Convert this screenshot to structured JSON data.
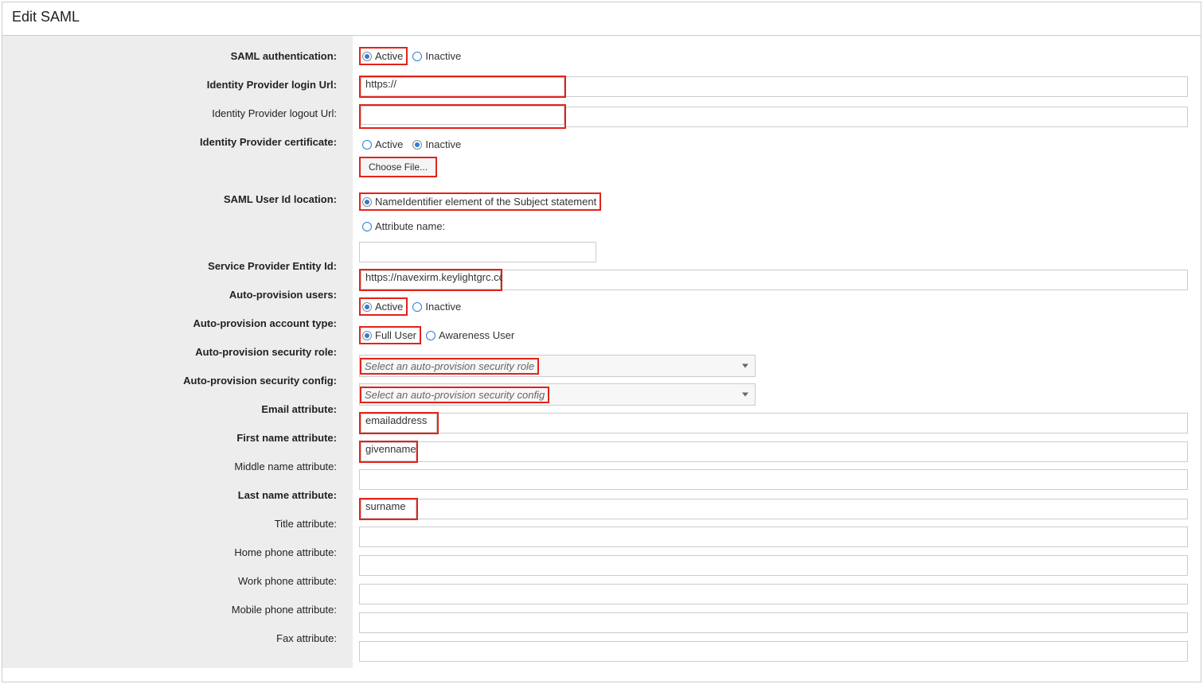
{
  "title": "Edit SAML",
  "labels": {
    "saml_auth": "SAML authentication:",
    "idp_login": "Identity Provider login Url:",
    "idp_logout": "Identity Provider logout Url:",
    "idp_cert": "Identity Provider certificate:",
    "userid_loc": "SAML User Id location:",
    "sp_entity": "Service Provider Entity Id:",
    "auto_prov": "Auto-provision users:",
    "auto_prov_type": "Auto-provision account type:",
    "auto_prov_role": "Auto-provision security role:",
    "auto_prov_config": "Auto-provision security config:",
    "email_attr": "Email attribute:",
    "first_name": "First name attribute:",
    "middle_name": "Middle name attribute:",
    "last_name": "Last name attribute:",
    "title_attr": "Title attribute:",
    "home_phone": "Home phone attribute:",
    "work_phone": "Work phone attribute:",
    "mobile_phone": "Mobile phone attribute:",
    "fax": "Fax attribute:"
  },
  "options": {
    "active": "Active",
    "inactive": "Inactive",
    "full_user": "Full User",
    "awareness_user": "Awareness User",
    "nameid": "NameIdentifier element of the Subject statement",
    "attr_name": "Attribute name:",
    "choose_file": "Choose File..."
  },
  "placeholders": {
    "role": "Select an auto-provision security role",
    "config": "Select an auto-provision security config"
  },
  "values": {
    "idp_login": "https://",
    "idp_logout": "",
    "attr_name_input": "",
    "sp_entity": "https://navexirm.keylightgrc.com/",
    "email_attr": "emailaddress",
    "first_name": "givenname",
    "middle_name": "",
    "last_name": "surname",
    "title_attr": "",
    "home_phone": "",
    "work_phone": "",
    "mobile_phone": "",
    "fax": ""
  },
  "state": {
    "saml_auth": "Active",
    "idp_cert": "Inactive",
    "userid_loc": "nameid",
    "auto_prov": "Active",
    "auto_prov_type": "Full User"
  }
}
